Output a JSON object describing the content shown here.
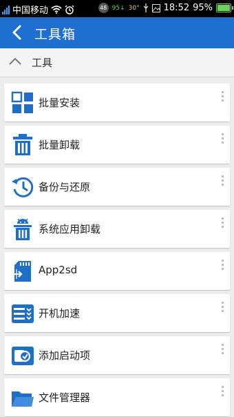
{
  "status": {
    "carrier": "中国移动",
    "time": "18:52",
    "battery": "95%",
    "badge": "48",
    "speed_down": "95↓",
    "temp": "30°"
  },
  "appbar": {
    "title": "工具箱"
  },
  "section": {
    "label": "工具"
  },
  "items": [
    {
      "label": "批量安装",
      "icon": "grid-icon"
    },
    {
      "label": "批量卸载",
      "icon": "trash-icon"
    },
    {
      "label": "备份与还原",
      "icon": "restore-clock-icon"
    },
    {
      "label": "系统应用卸载",
      "icon": "android-trash-icon"
    },
    {
      "label": "App2sd",
      "icon": "sd-card-icon"
    },
    {
      "label": "开机加速",
      "icon": "boost-list-icon"
    },
    {
      "label": "添加启动项",
      "icon": "startup-image-icon"
    },
    {
      "label": "文件管理器",
      "icon": "folder-icon"
    }
  ],
  "colors": {
    "accent": "#1e6fd0",
    "icon_blue": "#1f6ec8"
  }
}
